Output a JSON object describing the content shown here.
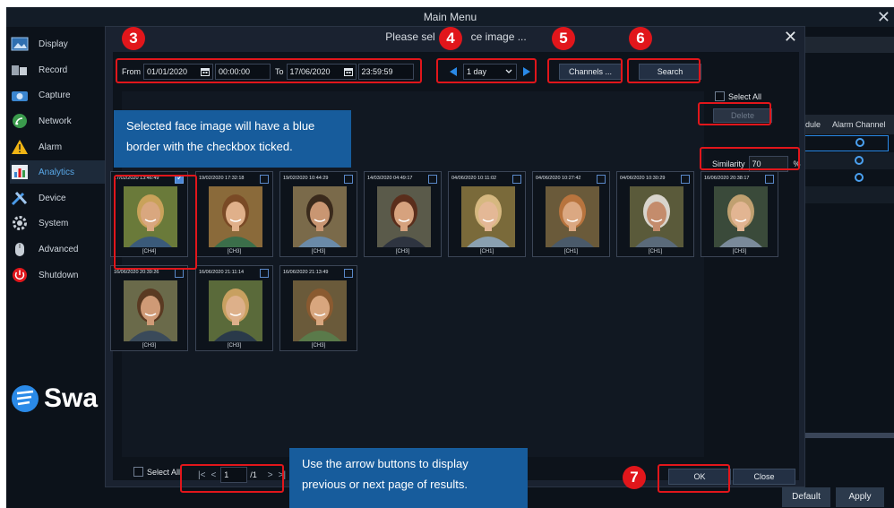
{
  "app": {
    "title": "Main Menu",
    "brand": "Swa",
    "close_glyph": "✕"
  },
  "sidebar": {
    "items": [
      {
        "label": "Display",
        "icon": "display-icon"
      },
      {
        "label": "Record",
        "icon": "record-icon"
      },
      {
        "label": "Capture",
        "icon": "capture-icon"
      },
      {
        "label": "Network",
        "icon": "network-icon"
      },
      {
        "label": "Alarm",
        "icon": "alarm-icon"
      },
      {
        "label": "Analytics",
        "icon": "analytics-icon",
        "active": true
      },
      {
        "label": "Device",
        "icon": "device-icon"
      },
      {
        "label": "System",
        "icon": "system-icon"
      },
      {
        "label": "Advanced",
        "icon": "advanced-icon"
      },
      {
        "label": "Shutdown",
        "icon": "power-icon"
      }
    ]
  },
  "background_panel": {
    "col_schedule": "dule",
    "col_alarm_channel": "Alarm Channel",
    "default_label": "Default",
    "apply_label": "Apply"
  },
  "dialog": {
    "title": "Please sel",
    "title_tail": "ce image ...",
    "close_glyph": "✕",
    "from_label": "From",
    "from_date": "01/01/2020",
    "from_time": "00:00:00",
    "to_label": "To",
    "to_date": "17/06/2020",
    "to_time": "23:59:59",
    "period": "1 day",
    "channels_label": "Channels ...",
    "search_label": "Search",
    "select_all_label": "Select All",
    "delete_label": "Delete",
    "similarity_label": "Similarity",
    "similarity_value": "70",
    "similarity_unit": "%",
    "footer_select_all": "Select All",
    "page_current": "1",
    "page_total": "/1",
    "ok_label": "OK",
    "close_label": "Close"
  },
  "results": [
    {
      "timestamp": "17/02/2020 13:46:49",
      "channel": "[CH4]",
      "checked": true
    },
    {
      "timestamp": "19/02/2020 17:32:18",
      "channel": "[CH3]",
      "checked": false
    },
    {
      "timestamp": "19/02/2020 10:44:29",
      "channel": "[CH3]",
      "checked": false
    },
    {
      "timestamp": "14/03/2020 04:49:17",
      "channel": "[CH3]",
      "checked": false
    },
    {
      "timestamp": "04/06/2020 10:11:02",
      "channel": "[CH1]",
      "checked": false
    },
    {
      "timestamp": "04/06/2020 10:27:42",
      "channel": "[CH1]",
      "checked": false
    },
    {
      "timestamp": "04/06/2020 10:30:29",
      "channel": "[CH1]",
      "checked": false
    },
    {
      "timestamp": "16/06/2020 20:38:17",
      "channel": "[CH3]",
      "checked": false
    },
    {
      "timestamp": "16/06/2020 20:39:26",
      "channel": "[CH3]",
      "checked": false
    },
    {
      "timestamp": "16/06/2020 21:11:14",
      "channel": "[CH3]",
      "checked": false
    },
    {
      "timestamp": "16/06/2020 21:13:49",
      "channel": "[CH3]",
      "checked": false
    }
  ],
  "annotations": {
    "badges": [
      "3",
      "4",
      "5",
      "6",
      "7"
    ],
    "callout_top": "Selected face image will have a blue border with the checkbox ticked.",
    "callout_bottom": "Use the arrow buttons to display previous or next page of results."
  },
  "colors": {
    "accent_red": "#e1161b",
    "callout_blue": "#175c9c",
    "active_blue": "#59a8e8",
    "arrow_blue": "#2a8ae8"
  }
}
